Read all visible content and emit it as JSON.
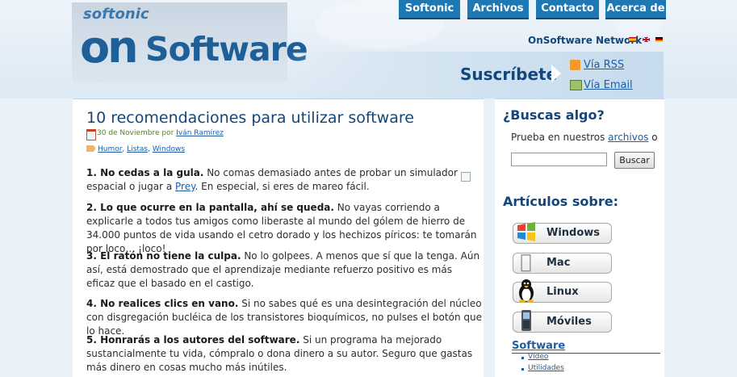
{
  "brand": {
    "softonic": "softonic",
    "on": "on",
    "software": "Software"
  },
  "nav": {
    "items": [
      "Softonic",
      "Archivos",
      "Contacto",
      "Acerca de"
    ]
  },
  "network": {
    "label": "OnSoftware Network"
  },
  "subscribe": {
    "title": "Suscríbete",
    "rss": "Vía RSS",
    "email": "Vía Email"
  },
  "post": {
    "title": "10 recomendaciones para utilizar software",
    "date": "30 de Noviembre por",
    "author": "Iván Ramírez",
    "tags": [
      "Humor",
      "Listas",
      "Windows"
    ],
    "paragraphs": [
      {
        "bold": "1. No cedas a la gula.",
        "text": " No comas demasiado antes de probar un simulador espacial o jugar a ",
        "link": "Prey",
        "after": ". En especial, si eres de mareo fácil."
      },
      {
        "bold": "2. Lo que ocurre en la pantalla, ahí se queda.",
        "text": " No vayas corriendo a explicarle a todos tus amigos como liberaste al mundo del gólem de hierro de 34.000 puntos de vida usando el cetro dorado y los hechizos píricos: te tomarán por loco… ¡loco!"
      },
      {
        "bold": "3. El ratón no tiene la culpa.",
        "text": " No lo golpees. A menos que sí que la tenga. Aún así, está demostrado que el aprendizaje mediante refuerzo positivo es más eficaz que el basado en el castigo."
      },
      {
        "bold": "4. No realices clics en vano.",
        "text": " Si no sabes qué es una desintegración del núcleo con disgregación bucléica de los transistores bioquímicos, no pulses el botón que lo hace."
      },
      {
        "bold": "5. Honrarás a los autores del software.",
        "text": " Si un programa ha mejorado sustancialmente tu vida, cómpralo o dona dinero a su autor. Seguro que gastas más dinero en cosas mucho más inútiles."
      }
    ]
  },
  "sidebar": {
    "search": {
      "heading": "¿Buscas algo?",
      "text_before": "Prueba en nuestros ",
      "link": "archivos",
      "text_after": " o",
      "input_value": "",
      "button": "Buscar"
    },
    "articles": {
      "heading": "Artículos sobre:",
      "buttons": [
        {
          "label": "Windows",
          "icon": "windows-icon"
        },
        {
          "label": "Mac",
          "icon": "apple-icon"
        },
        {
          "label": "Linux",
          "icon": "penguin-icon"
        },
        {
          "label": "Móviles",
          "icon": "phone-icon"
        }
      ]
    },
    "software": {
      "heading": "Software",
      "items": [
        "Vídeo",
        "Utilidades"
      ]
    }
  }
}
